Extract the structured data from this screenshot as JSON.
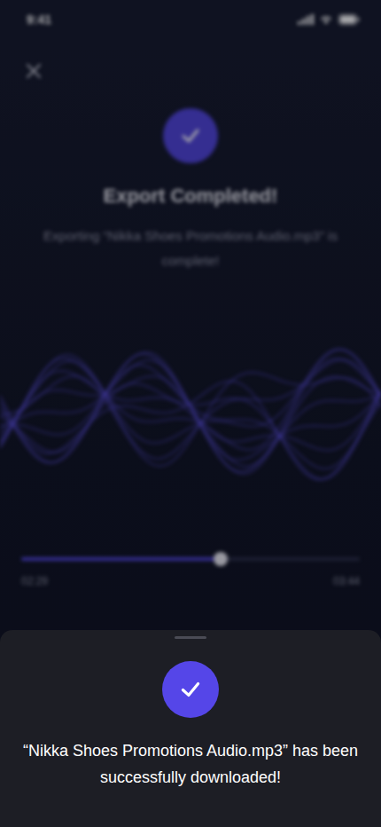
{
  "status_bar": {
    "time": "9:41"
  },
  "export": {
    "title": "Export Completed!",
    "message": "Exporting “Nikka Shoes Promotions Audio.mp3” is complete!"
  },
  "player": {
    "level": 0.59,
    "elapsed": "02:29",
    "total": "03:44"
  },
  "toast": {
    "message": "“Nikka Shoes Promotions Audio.mp3” has been successfully downloaded!"
  }
}
